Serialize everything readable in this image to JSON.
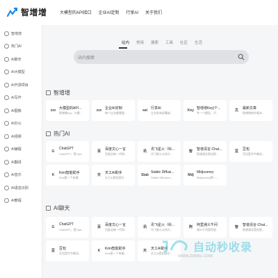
{
  "brand": {
    "name": "智增增"
  },
  "topnav": [
    "大模型的API接口",
    "企业AI定制",
    "行享AI",
    "关于我们"
  ],
  "sidebar": [
    "智增增",
    "热门AI",
    "AI聊天",
    "AI大模型",
    "AI开源项目",
    "AI写作",
    "AI图像",
    "AI办公",
    "AI视频",
    "AI编程",
    "AI翻译",
    "AI音乐",
    "AI语音识别",
    "AI教程"
  ],
  "search": {
    "tabs": [
      "站内",
      "常用",
      "搜索",
      "工具",
      "社区",
      "生活"
    ],
    "active": 0,
    "placeholder": "站内搜索"
  },
  "sections": [
    {
      "title": "智增增",
      "cards": [
        {
          "name": "大模型的API...",
          "desc": "智增增Api，大模...",
          "thumb": "zzz"
        },
        {
          "name": "企业AI定制",
          "desc": "每个企业都需要...",
          "thumb": "zzz"
        },
        {
          "name": "行享AI",
          "desc": "企业私有部署或...",
          "thumb": "xai"
        },
        {
          "name": "智增增Key(个...",
          "desc": "专一个模型，不...",
          "thumb": "Key"
        },
        {
          "name": "最新文章",
          "desc": "智增增软件版本...",
          "thumb": "文"
        }
      ]
    },
    {
      "title": "热门AI",
      "cards": [
        {
          "name": "ChatGPT",
          "desc": "ChatGPT，是Ope...",
          "thumb": "G"
        },
        {
          "name": "百度文心一言",
          "desc": "百度全新一代知...",
          "thumb": "百"
        },
        {
          "name": "讯飞星火（科...",
          "desc": "讯飞星火认知大...",
          "thumb": "讯"
        },
        {
          "name": "智谱清言-Chat...",
          "desc": "智谱清言是由智...",
          "thumb": "智"
        },
        {
          "name": "豆包",
          "desc": "豆包是字节跳动...",
          "thumb": "豆"
        },
        {
          "name": "Kimi智能助手",
          "desc": "Kimi是一个有着...",
          "thumb": "K"
        },
        {
          "name": "天工AI助手",
          "desc": "天工AI是由昆仑...",
          "thumb": "天"
        },
        {
          "name": "Stable Diffusi...",
          "desc": "Stable Diffusion...",
          "thumb": "Stab"
        },
        {
          "name": "Midjourney",
          "desc": "Midjourney是一...",
          "thumb": "Mdj"
        }
      ]
    },
    {
      "title": "AI聊天",
      "cards": [
        {
          "name": "ChatGPT",
          "desc": "ChatGPT，是Ope...",
          "thumb": "G"
        },
        {
          "name": "百度文心一言",
          "desc": "百度全新一代知...",
          "thumb": "百"
        },
        {
          "name": "讯飞星火（科...",
          "desc": "讯飞星火认知大...",
          "thumb": "讯"
        },
        {
          "name": "阿里通义千问",
          "desc": "通义千问是阿里...",
          "thumb": "阿"
        },
        {
          "name": "智谱清言-Chat...",
          "desc": "智谱清言是由智...",
          "thumb": "智"
        },
        {
          "name": "豆包",
          "desc": "豆包是字节跳动...",
          "thumb": "豆"
        },
        {
          "name": "Kimi智能助手",
          "desc": "Kimi是一个有着...",
          "thumb": "K"
        },
        {
          "name": "天工AI助手",
          "desc": "天工AI是由昆仑...",
          "thumb": "天"
        }
      ]
    }
  ],
  "watermark": {
    "title": "自动秒收录",
    "subtitle": "WWW.ZDMSL.COM"
  },
  "colors": {
    "accent": "#1e88e5",
    "background": "#f5f6f7",
    "card": "#ffffff",
    "search": "#dfe1e4"
  }
}
